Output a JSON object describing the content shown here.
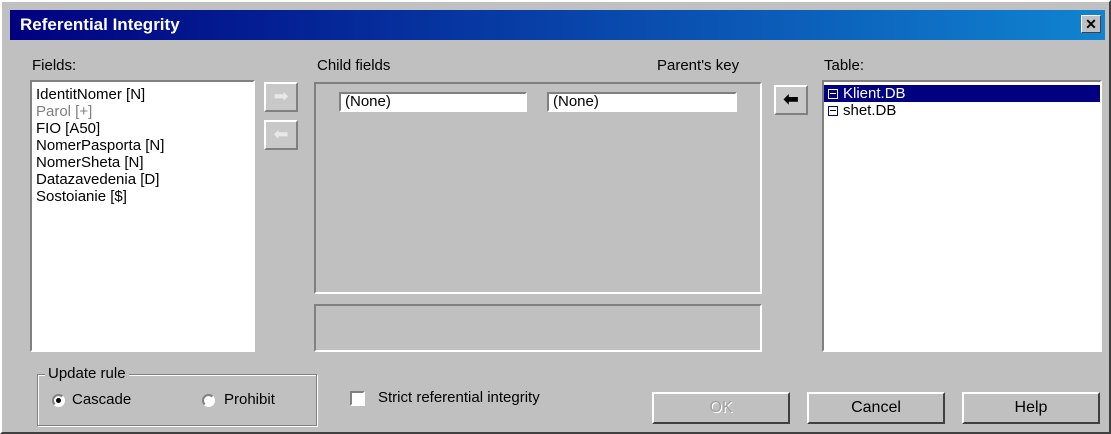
{
  "window": {
    "title": "Referential Integrity",
    "close_symbol": "✕"
  },
  "fields": {
    "label": "Fields:",
    "items": [
      {
        "text": "IdentitNomer [N]",
        "disabled": false
      },
      {
        "text": "Parol [+]",
        "disabled": true
      },
      {
        "text": "FIO [A50]",
        "disabled": false
      },
      {
        "text": "NomerPasporta [N]",
        "disabled": false
      },
      {
        "text": "NomerSheta [N]",
        "disabled": false
      },
      {
        "text": "Datazavedenia [D]",
        "disabled": false
      },
      {
        "text": "Sostoianie [$]",
        "disabled": false
      }
    ]
  },
  "mapping": {
    "child_label": "Child fields",
    "parent_label": "Parent's key",
    "child_value": "(None)",
    "parent_value": "(None)",
    "add_symbol": "➡",
    "remove_symbol": "⬅",
    "table_add_symbol": "⬅"
  },
  "table": {
    "label": "Table:",
    "items": [
      {
        "text": "Klient.DB",
        "selected": true
      },
      {
        "text": "shet.DB",
        "selected": false
      }
    ]
  },
  "update_rule": {
    "caption": "Update rule",
    "options": [
      {
        "label": "Cascade",
        "checked": true
      },
      {
        "label": "Prohibit",
        "checked": false
      }
    ]
  },
  "strict": {
    "label": "Strict referential integrity",
    "checked": false
  },
  "buttons": {
    "ok": "OK",
    "cancel": "Cancel",
    "help": "Help"
  }
}
